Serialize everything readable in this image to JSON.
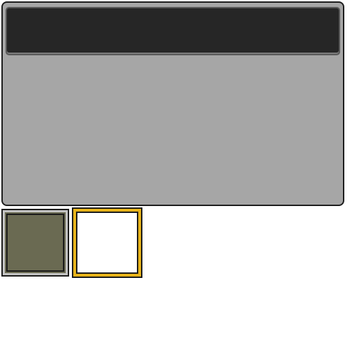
{
  "window": {
    "title": ""
  },
  "palette": {
    "swatches": [
      {
        "name": "olive",
        "color": "#6a6a52",
        "selected": false
      },
      {
        "name": "white",
        "color": "#ffffff",
        "selected": true
      }
    ],
    "selection_color": "#e8b41a"
  },
  "colors": {
    "titlebar": "#262626",
    "panel": "#a6a6a6",
    "frame": "#1c1c1c"
  }
}
